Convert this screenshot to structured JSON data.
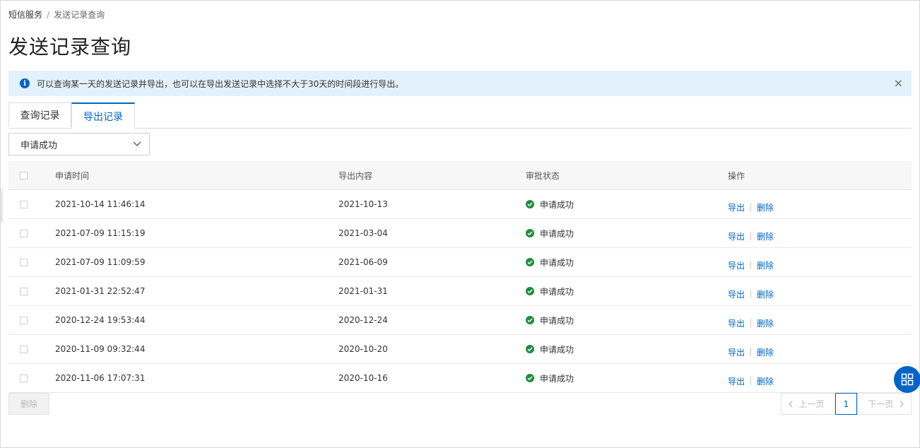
{
  "breadcrumb": {
    "parent": "短信服务",
    "separator": "/",
    "current": "发送记录查询"
  },
  "page_title": "发送记录查询",
  "alert": {
    "message": "可以查询某一天的发送记录并导出，也可以在导出发送记录中选择不大于30天的时间段进行导出。",
    "info_icon": "i",
    "close_icon": "×"
  },
  "tabs": [
    {
      "label": "查询记录"
    },
    {
      "label": "导出记录",
      "active": true
    }
  ],
  "filter": {
    "selected": "申请成功"
  },
  "table": {
    "columns": [
      "申请时间",
      "导出内容",
      "审批状态",
      "操作"
    ],
    "rows": [
      {
        "time": "2021-10-14 11:46:14",
        "content": "2021-10-13",
        "status": "申请成功"
      },
      {
        "time": "2021-07-09 11:15:19",
        "content": "2021-03-04",
        "status": "申请成功"
      },
      {
        "time": "2021-07-09 11:09:59",
        "content": "2021-06-09",
        "status": "申请成功"
      },
      {
        "time": "2021-01-31 22:52:47",
        "content": "2021-01-31",
        "status": "申请成功"
      },
      {
        "time": "2020-12-24 19:53:44",
        "content": "2020-12-24",
        "status": "申请成功"
      },
      {
        "time": "2020-11-09 09:32:44",
        "content": "2020-10-20",
        "status": "申请成功"
      },
      {
        "time": "2020-11-06 17:07:31",
        "content": "2020-10-16",
        "status": "申请成功"
      }
    ],
    "actions": {
      "export": "导出",
      "delete": "删除"
    }
  },
  "footer": {
    "delete_label": "删除"
  },
  "pagination": {
    "prev": "上一页",
    "current": "1",
    "next": "下一页"
  },
  "colors": {
    "accent": "#0064c8",
    "success": "#1e8e3e",
    "alert_bg": "#e3f1fc"
  }
}
